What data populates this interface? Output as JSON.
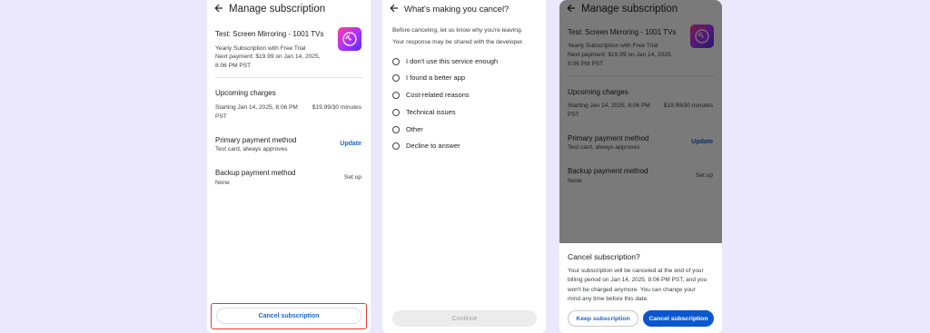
{
  "manage": {
    "title": "Manage subscription",
    "app_name": "Test: Screen Mirroring - 1001 TVs",
    "plan": "Yearly Subscription with Free Trial",
    "next_payment_line1": "Next payment: $19.99 on Jan 14, 2025,",
    "next_payment_line2": "8:06 PM PST",
    "upcoming_heading": "Upcoming charges",
    "upcoming_start_line1": "Starting Jan 14, 2025, 8:06 PM",
    "upcoming_start_line2": "PST",
    "upcoming_price": "$19.99/30 minutes",
    "primary_heading": "Primary payment method",
    "primary_value": "Test card, always approves",
    "update_label": "Update",
    "backup_heading": "Backup payment method",
    "backup_value": "None",
    "setup_label": "Set up",
    "cancel_label": "Cancel subscription"
  },
  "reason": {
    "title": "What's making you cancel?",
    "intro_line1": "Before canceling, let us know why you're leaving.",
    "intro_line2": "Your response may be shared with the developer.",
    "options": [
      "I don't use this service enough",
      "I found a better app",
      "Cost-related reasons",
      "Technical issues",
      "Other",
      "Decline to answer"
    ],
    "continue_label": "Continue"
  },
  "dialog": {
    "title": "Cancel subscription?",
    "body_line1": "Your subscription will be canceled at the end of your",
    "body_line2": "billing period on Jan 14, 2025, 8:06 PM PST, and you",
    "body_line3": "won't be charged anymore. You can change your",
    "body_line4": "mind any time before this date.",
    "keep_label": "Keep subscription",
    "cancel_label": "Cancel subscription"
  },
  "colors": {
    "background": "#ece8fb",
    "accent": "#0b57d0",
    "highlight": "#e53935"
  }
}
